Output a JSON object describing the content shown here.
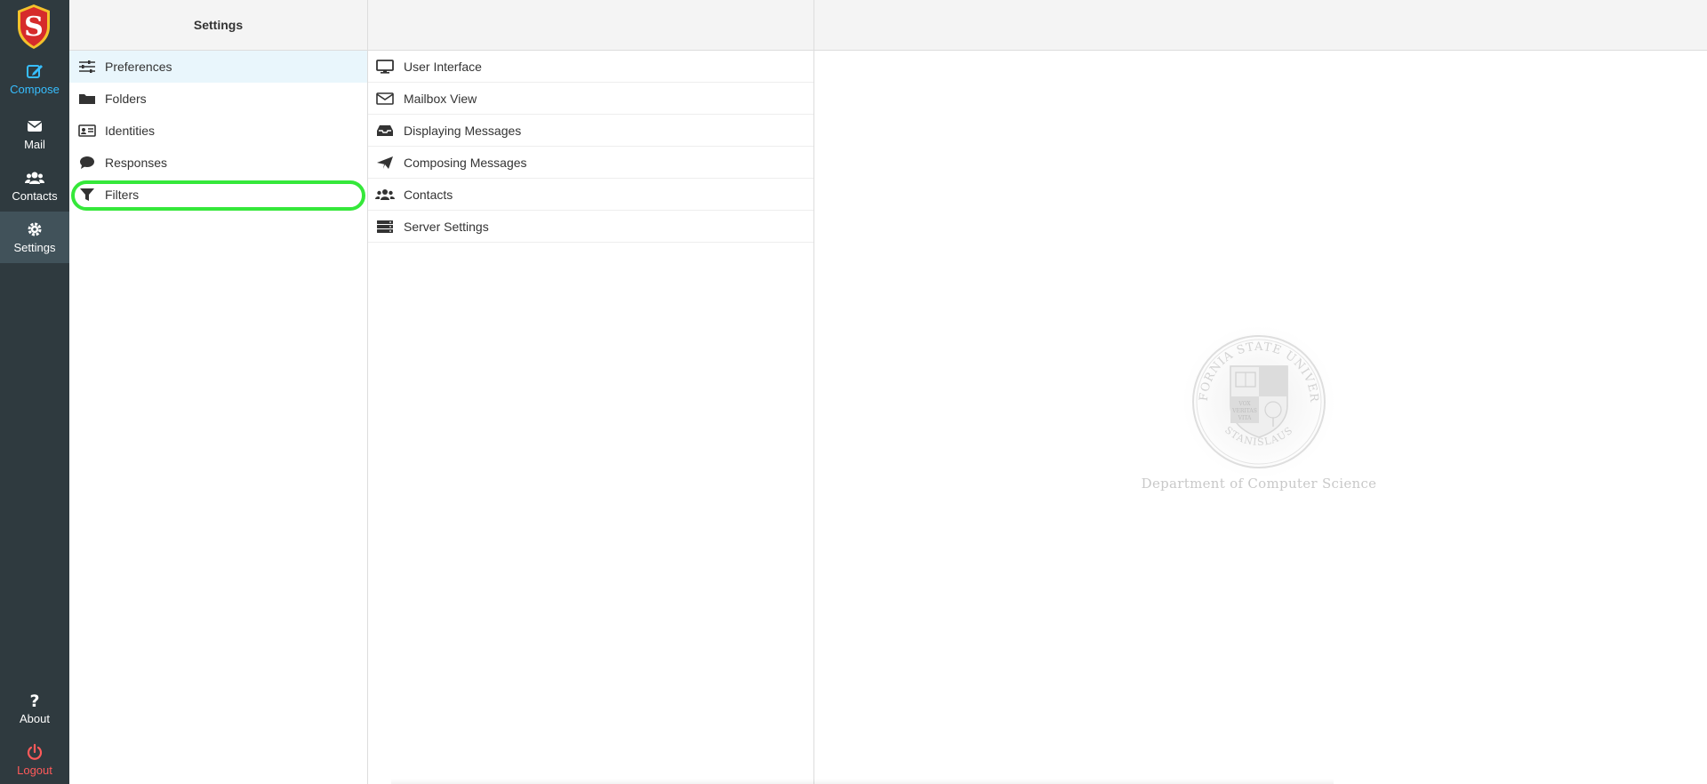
{
  "nav": {
    "compose": "Compose",
    "mail": "Mail",
    "contacts": "Contacts",
    "settings": "Settings",
    "about": "About",
    "logout": "Logout",
    "logo_letter": "S"
  },
  "settings_list": {
    "header": "Settings",
    "items": [
      {
        "label": "Preferences",
        "icon": "sliders-icon"
      },
      {
        "label": "Folders",
        "icon": "folder-icon"
      },
      {
        "label": "Identities",
        "icon": "id-card-icon"
      },
      {
        "label": "Responses",
        "icon": "comment-icon"
      },
      {
        "label": "Filters",
        "icon": "filter-icon"
      }
    ],
    "selected": "Preferences",
    "highlighted": "Filters"
  },
  "sections": {
    "items": [
      {
        "label": "User Interface",
        "icon": "monitor-icon"
      },
      {
        "label": "Mailbox View",
        "icon": "envelope-icon"
      },
      {
        "label": "Displaying Messages",
        "icon": "inbox-icon"
      },
      {
        "label": "Composing Messages",
        "icon": "paper-plane-icon"
      },
      {
        "label": "Contacts",
        "icon": "users-icon"
      },
      {
        "label": "Server Settings",
        "icon": "server-icon"
      }
    ]
  },
  "watermark": {
    "department": "Department of Computer Science",
    "seal_top": "CALIFORNIA STATE UNIVERSITY",
    "seal_bottom": "STANISLAUS",
    "motto": [
      "VOX",
      "VERITAS",
      "VITA"
    ]
  },
  "colors": {
    "nav_bg": "#2f3a3f",
    "nav_active_bg": "#41525a",
    "accent": "#37beff",
    "logout": "#ff5a5a",
    "highlight_ring": "#35e83a",
    "selected_row": "#e9f6fc"
  }
}
